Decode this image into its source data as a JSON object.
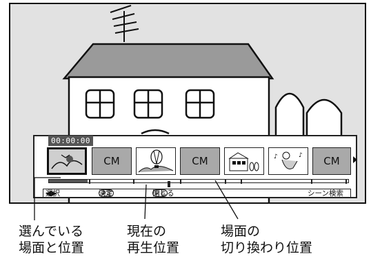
{
  "screen": {
    "timecode": "00:00:00",
    "thumbnails": [
      {
        "kind": "picture",
        "icon": "bird-over-tree-icon",
        "selected": true
      },
      {
        "kind": "text",
        "label": "CM"
      },
      {
        "kind": "picture",
        "icon": "balloon-icon"
      },
      {
        "kind": "text",
        "label": "CM"
      },
      {
        "kind": "picture",
        "icon": "school-building-icon"
      },
      {
        "kind": "picture",
        "icon": "musician-icon"
      },
      {
        "kind": "text",
        "label": "CM"
      }
    ],
    "progress_fraction": 0.13,
    "menu": {
      "select_label": "選択",
      "enter_chip": "決定",
      "enter_label": "決定",
      "back_chip": "戻る",
      "back_label": "閉じる",
      "search_label": "シーン検索"
    }
  },
  "callouts": {
    "selected": {
      "line1": "選んでいる",
      "line2": "場面と位置"
    },
    "current": {
      "line1": "現在の",
      "line2": "再生位置"
    },
    "switch": {
      "line1": "場面の",
      "line2": "切り換わり位置"
    }
  },
  "colors": {
    "panel_bg": "#ffffff",
    "scene_bg": "#e2e2e2",
    "thumb_cm": "#a9a9a9",
    "progress": "#555555"
  }
}
